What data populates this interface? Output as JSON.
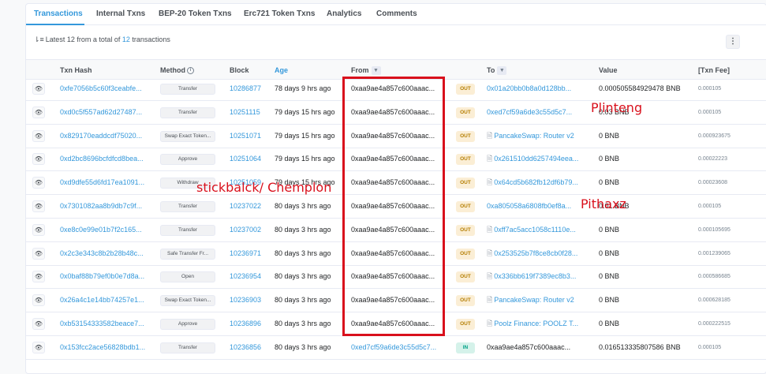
{
  "tabs": [
    {
      "label": "Transactions"
    },
    {
      "label": "Internal Txns"
    },
    {
      "label": "BEP-20 Token Txns"
    },
    {
      "label": "Erc721 Token Txns"
    },
    {
      "label": "Analytics"
    },
    {
      "label": "Comments"
    }
  ],
  "summary": {
    "prefix": "Latest 12 from a total of ",
    "count": "12",
    "suffix": " transactions"
  },
  "more_button": "⋮",
  "columns": {
    "txn_hash": "Txn Hash",
    "method": "Method",
    "block": "Block",
    "age": "Age",
    "from": "From",
    "to": "To",
    "value": "Value",
    "fee": "[Txn Fee]"
  },
  "rows": [
    {
      "hash": "0xfe7056b5c60f3ceabfe...",
      "method": "Transfer",
      "block": "10286877",
      "age": "78 days 9 hrs ago",
      "from": "0xaa9ae4a857c600aaac...",
      "dir": "OUT",
      "to": "0x01a20bb0b8a0d128bb...",
      "to_contract": false,
      "value": "0.000505584929478 BNB",
      "fee": "0.000105"
    },
    {
      "hash": "0xd0c5f557ad62d27487...",
      "method": "Transfer",
      "block": "10251115",
      "age": "79 days 15 hrs ago",
      "from": "0xaa9ae4a857c600aaac...",
      "dir": "OUT",
      "to": "0xed7cf59a6de3c55d5c7...",
      "to_contract": false,
      "value": "0.03 BNB",
      "fee": "0.000105"
    },
    {
      "hash": "0x829170eaddcdf75020...",
      "method": "Swap Exact Token...",
      "block": "10251071",
      "age": "79 days 15 hrs ago",
      "from": "0xaa9ae4a857c600aaac...",
      "dir": "OUT",
      "to": "PancakeSwap: Router v2",
      "to_contract": true,
      "value": "0 BNB",
      "fee": "0.000923675"
    },
    {
      "hash": "0xd2bc8696bcfdfcd8bea...",
      "method": "Approve",
      "block": "10251064",
      "age": "79 days 15 hrs ago",
      "from": "0xaa9ae4a857c600aaac...",
      "dir": "OUT",
      "to": "0x261510dd6257494eea...",
      "to_contract": true,
      "value": "0 BNB",
      "fee": "0.00022223"
    },
    {
      "hash": "0xd9dfe55d6fd17ea1091...",
      "method": "Withdraw",
      "block": "10251059",
      "age": "79 days 15 hrs ago",
      "from": "0xaa9ae4a857c600aaac...",
      "dir": "OUT",
      "to": "0x64cd5b682fb12df6b79...",
      "to_contract": true,
      "value": "0 BNB",
      "fee": "0.00023608"
    },
    {
      "hash": "0x7301082aa8b9db7c9f...",
      "method": "Transfer",
      "block": "10237022",
      "age": "80 days 3 hrs ago",
      "from": "0xaa9ae4a857c600aaac...",
      "dir": "OUT",
      "to": "0xa805058a6808fb0ef8a...",
      "to_contract": false,
      "value": "0.01 BNB",
      "fee": "0.000105"
    },
    {
      "hash": "0xe8c0e99e01b7f2c165...",
      "method": "Transfer",
      "block": "10237002",
      "age": "80 days 3 hrs ago",
      "from": "0xaa9ae4a857c600aaac...",
      "dir": "OUT",
      "to": "0xff7ac5acc1058c1110e...",
      "to_contract": true,
      "value": "0 BNB",
      "fee": "0.000105695"
    },
    {
      "hash": "0x2c3e343c8b2b28b48c...",
      "method": "Safe Transfer Fr...",
      "block": "10236971",
      "age": "80 days 3 hrs ago",
      "from": "0xaa9ae4a857c600aaac...",
      "dir": "OUT",
      "to": "0x253525b7f8ce8cb0f28...",
      "to_contract": true,
      "value": "0 BNB",
      "fee": "0.001239065"
    },
    {
      "hash": "0x0baf88b79ef0b0e7d8a...",
      "method": "Open",
      "block": "10236954",
      "age": "80 days 3 hrs ago",
      "from": "0xaa9ae4a857c600aaac...",
      "dir": "OUT",
      "to": "0x336bb619f7389ec8b3...",
      "to_contract": true,
      "value": "0 BNB",
      "fee": "0.000586685"
    },
    {
      "hash": "0x26a4c1e14bb74257e1...",
      "method": "Swap Exact Token...",
      "block": "10236903",
      "age": "80 days 3 hrs ago",
      "from": "0xaa9ae4a857c600aaac...",
      "dir": "OUT",
      "to": "PancakeSwap: Router v2",
      "to_contract": true,
      "value": "0 BNB",
      "fee": "0.000628185"
    },
    {
      "hash": "0xb53154333582beace7...",
      "method": "Approve",
      "block": "10236896",
      "age": "80 days 3 hrs ago",
      "from": "0xaa9ae4a857c600aaac...",
      "dir": "OUT",
      "to": "Poolz Finance: POOLZ T...",
      "to_contract": true,
      "value": "0 BNB",
      "fee": "0.000222515"
    },
    {
      "hash": "0x153fcc2ace56828bdb1...",
      "method": "Transfer",
      "block": "10236856",
      "age": "80 days 3 hrs ago",
      "from": "0xed7cf59a6de3c55d5c7...",
      "dir": "IN",
      "to": "0xaa9ae4a857c600aaac...",
      "to_contract": false,
      "value": "0.016513335807586 BNB",
      "fee": "0.000105"
    }
  ],
  "annotations": [
    {
      "text": "Plinteng"
    },
    {
      "text": "stickbalck/ Chemplon"
    },
    {
      "text": "Pithaxz"
    }
  ],
  "colors": {
    "accent": "#3498db",
    "highlight_box": "#d9101c",
    "out_badge": "#fbeed5",
    "in_badge": "#d5f2ea"
  }
}
